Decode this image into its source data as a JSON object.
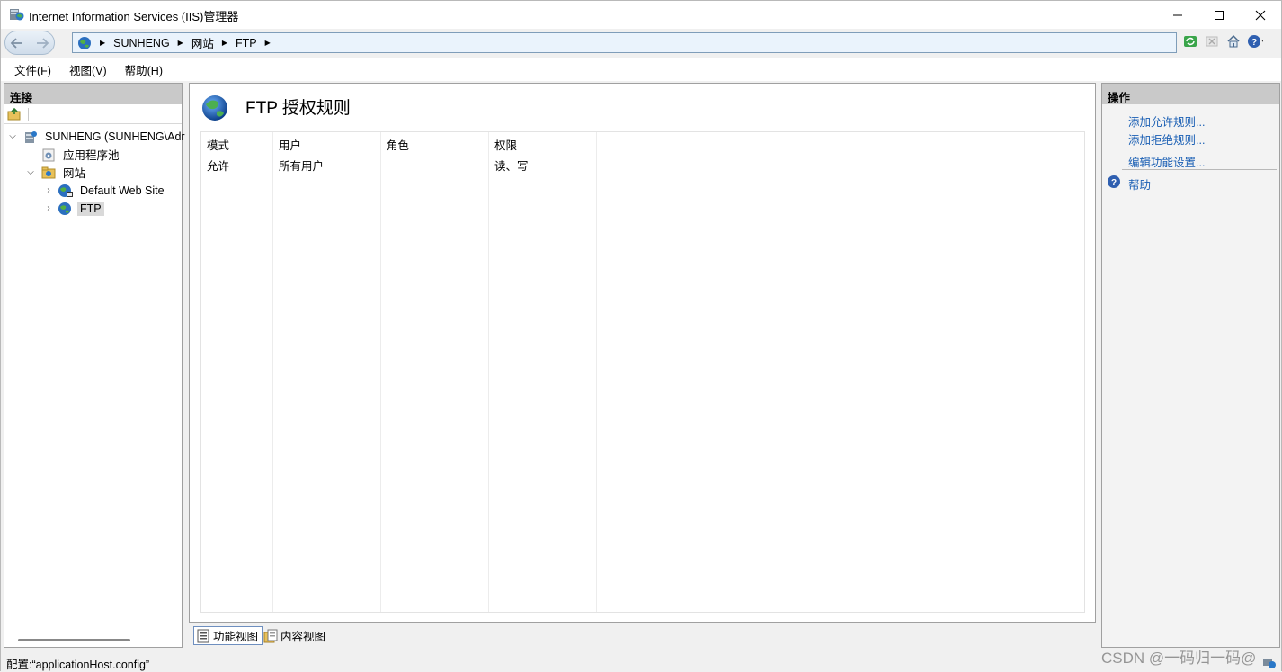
{
  "window": {
    "title": "Internet Information Services (IIS)管理器"
  },
  "address": {
    "crumbs": [
      "SUNHENG",
      "网站",
      "FTP"
    ]
  },
  "menu": {
    "file": "文件(F)",
    "view": "视图(V)",
    "help": "帮助(H)"
  },
  "connections": {
    "header": "连接",
    "tree": {
      "server": "SUNHENG (SUNHENG\\Adr",
      "app_pools": "应用程序池",
      "sites": "网站",
      "default_site": "Default Web Site",
      "ftp": "FTP"
    }
  },
  "main": {
    "title": "FTP 授权规则",
    "columns": [
      "模式",
      "用户",
      "角色",
      "权限"
    ],
    "rows": [
      {
        "mode": "允许",
        "user": "所有用户",
        "role": "",
        "permission": "读、写"
      }
    ]
  },
  "bottom_tabs": {
    "feature_view": "功能视图",
    "content_view": "内容视图"
  },
  "actions": {
    "header": "操作",
    "add_allow": "添加允许规则...",
    "add_deny": "添加拒绝规则...",
    "edit_settings": "编辑功能设置...",
    "help": "帮助"
  },
  "status": {
    "text": "配置:“applicationHost.config”"
  },
  "watermark": "CSDN @一码归一码@",
  "colors": {
    "link": "#1a5fb4",
    "panel_header": "#c9c9c9"
  }
}
